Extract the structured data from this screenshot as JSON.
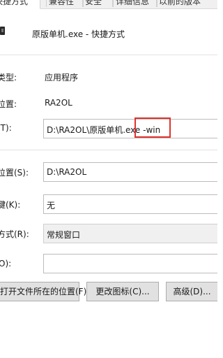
{
  "tabs": [
    "快捷方式",
    "兼容性",
    "安全",
    "详细信息",
    "以前的版本"
  ],
  "shortcut_name": "原版单机.exe - 快捷方式",
  "rows": {
    "target_type": {
      "label": "类型:",
      "value": "应用程序"
    },
    "target_location": {
      "label": "位置:",
      "value": "RA2OL"
    },
    "target": {
      "label": "(T):",
      "value": "D:\\RA2OL\\原版单机.exe -win"
    },
    "start_in": {
      "label": "位置(S):",
      "value": "D:\\RA2OL"
    },
    "shortcut_key": {
      "label": "键(K):",
      "value": "无"
    },
    "run": {
      "label": "方式(R):",
      "value": "常规窗口"
    },
    "comment": {
      "label": "O):",
      "value": ""
    }
  },
  "buttons": {
    "open_location": "打开文件所在的位置(F)",
    "change_icon": "更改图标(C)...",
    "advanced": "高级(D)..."
  },
  "colors": {
    "highlight_box": "#e0322c",
    "button_face": "#e1e1e1"
  }
}
